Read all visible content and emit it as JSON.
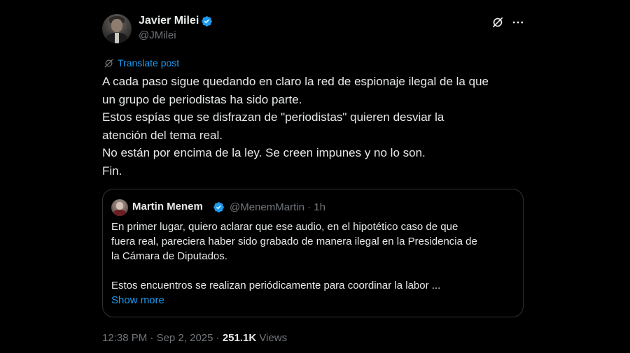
{
  "author": {
    "name": "Javier Milei",
    "handle": "@JMilei",
    "verified": true
  },
  "header_icons": [
    "grok-icon",
    "more-icon"
  ],
  "translate_label": "Translate post",
  "tweet_lines": [
    "A cada paso sigue quedando en claro la red de espionaje ilegal de la que",
    "un grupo de periodistas ha sido parte.",
    "Estos espías que se disfrazan de \"periodistas\" quieren desviar la",
    "atención del tema real.",
    "No están por encima de la ley. Se creen impunes y no lo son.",
    "Fin."
  ],
  "quote": {
    "name": "Martin Menem",
    "handle_time": "@MenemMartin · 1h",
    "verified": true,
    "text_lines": [
      "En primer lugar, quiero aclarar que ese audio, en el hipotético caso de que",
      "fuera real, pareciera haber sido grabado de manera ilegal en la Presidencia de",
      "la Cámara de Diputados.",
      "",
      "Estos encuentros se realizan periódicamente para coordinar la labor ..."
    ],
    "show_more": "Show more"
  },
  "meta": {
    "time": "12:38 PM",
    "date": "Sep 2, 2025",
    "separator": "·",
    "views_count": "251.1K",
    "views_label": "Views"
  },
  "colors": {
    "background": "#000000",
    "text": "#e7e9ea",
    "secondary": "#71767b",
    "accent": "#1d9bf0",
    "border": "#2f3336"
  }
}
